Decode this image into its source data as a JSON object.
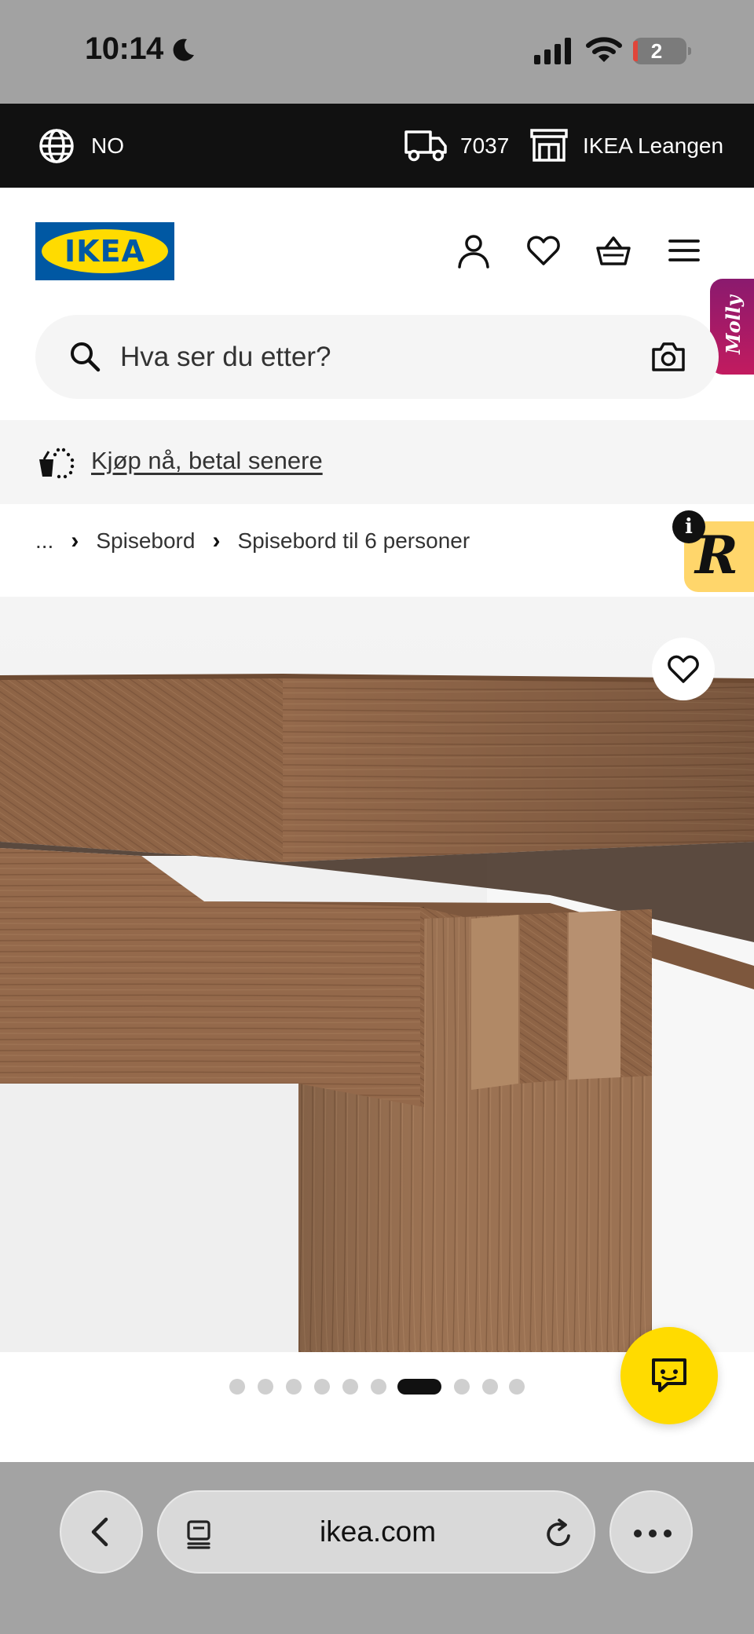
{
  "status_bar": {
    "time": "10:14",
    "battery_level": "2",
    "icons": [
      "moon-icon",
      "cellular-signal-icon",
      "wifi-icon",
      "battery-icon"
    ]
  },
  "top_bar": {
    "language": "NO",
    "postcode": "7037",
    "store": "IKEA Leangen",
    "icons": [
      "globe-icon",
      "delivery-truck-icon",
      "store-icon"
    ]
  },
  "header": {
    "logo_text": "IKEA",
    "icons": [
      "account-icon",
      "wishlist-heart-icon",
      "shopping-basket-icon",
      "menu-icon"
    ],
    "molly_label": "Molly"
  },
  "search": {
    "placeholder": "Hva ser du etter?",
    "icons": [
      "search-icon",
      "camera-icon"
    ]
  },
  "banner": {
    "link_text": "Kjøp nå, betal senere",
    "icon": "buy-now-basket-icon"
  },
  "breadcrumb": {
    "items": [
      "...",
      "Spisebord",
      "Spisebord til 6 personer"
    ]
  },
  "widget": {
    "letter": "R",
    "info": "i"
  },
  "gallery": {
    "image_count": 10,
    "active_index": 6,
    "wishlist_icon": "heart-icon"
  },
  "chat": {
    "icon": "chat-icon"
  },
  "browser": {
    "url": "ikea.com",
    "icons": [
      "back-icon",
      "tabs-icon",
      "reload-icon",
      "more-icon"
    ]
  },
  "colors": {
    "ikea_blue": "#0058a3",
    "ikea_yellow": "#ffdb00",
    "top_bar": "#111111",
    "search_bg": "#f5f5f5",
    "wood": "#8a6146"
  }
}
